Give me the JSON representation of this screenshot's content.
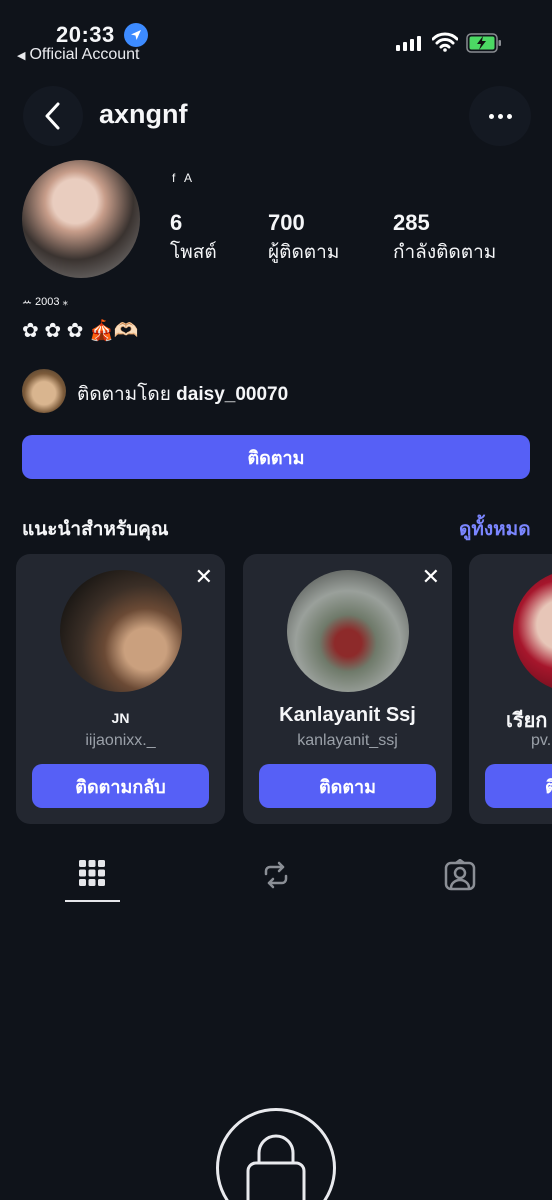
{
  "status_bar": {
    "time": "20:33",
    "back_label": "Official Account"
  },
  "header": {
    "username": "axngnf"
  },
  "profile": {
    "full_name": "f A",
    "stats": [
      {
        "value": "6",
        "label": "โพสต์"
      },
      {
        "value": "700",
        "label": "ผู้ติดตาม"
      },
      {
        "value": "285",
        "label": "กำลังติดตาม"
      }
    ],
    "bio_line1": "ꕀ 2003 ⁎",
    "bio_line2": "✿ ✿ ✿ 🎪🫶🏻",
    "followed_by_prefix": "ติดตามโดย ",
    "followed_by_user": "daisy_00070",
    "follow_button": "ติดตาม"
  },
  "suggestions": {
    "title": "แนะนำสำหรับคุณ",
    "see_all": "ดูทั้งหมด",
    "cards": [
      {
        "name": "JN",
        "handle": "iijaonixx._",
        "button": "ติดตามกลับ"
      },
      {
        "name": "Kanlayanit Ssj",
        "handle": "kanlayanit_ssj",
        "button": "ติดตาม"
      },
      {
        "name": "เรียก",
        "handle": "pv.",
        "button": "ติ"
      }
    ]
  },
  "colors": {
    "background": "#0f131a",
    "accent": "#5660f6",
    "link": "#7b86ff",
    "card": "#232730"
  },
  "icons": [
    "location-arrow-icon",
    "signal-icon",
    "wifi-icon",
    "battery-charging-icon",
    "chevron-left-icon",
    "more-dots-icon",
    "grid-icon",
    "repost-icon",
    "tagged-person-icon",
    "lock-icon",
    "close-icon"
  ]
}
